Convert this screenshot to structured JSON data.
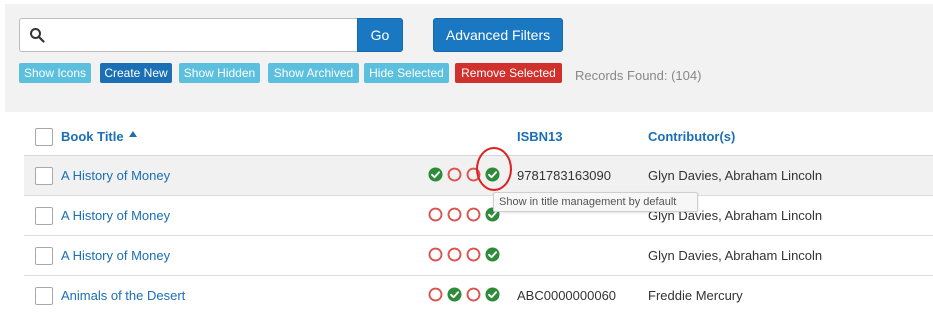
{
  "colors": {
    "primary": "#1a78c2",
    "link": "#1a6fb5",
    "info": "#5bc0de",
    "danger": "#d0312d",
    "status_on": "#2e8b3a",
    "status_off": "#d9534f",
    "highlight": "#e02020"
  },
  "search": {
    "placeholder": "",
    "value": "",
    "icon": "search-icon",
    "go_label": "Go"
  },
  "advanced_filters_label": "Advanced Filters",
  "toolbar_buttons": [
    {
      "label": "Show Icons",
      "style": "light"
    },
    {
      "label": "Create New",
      "style": "dark"
    },
    {
      "label": "Show Hidden",
      "style": "light"
    },
    {
      "label": "Show Archived",
      "style": "light"
    },
    {
      "label": "Hide Selected",
      "style": "light"
    },
    {
      "label": "Remove Selected",
      "style": "danger"
    }
  ],
  "records_found": "Records Found: (104)",
  "table": {
    "columns": {
      "title": "Book Title",
      "isbn": "ISBN13",
      "contributors": "Contributor(s)"
    },
    "sort": {
      "column": "title",
      "direction": "asc",
      "icon": "sort-up-icon"
    },
    "rows": [
      {
        "title": "A History of Money",
        "status": [
          "on",
          "off",
          "off",
          "on"
        ],
        "isbn": "9781783163090",
        "contributors": "Glyn Davies, Abraham Lincoln",
        "hovered": true
      },
      {
        "title": "A History of Money",
        "status": [
          "off",
          "off",
          "off",
          "on"
        ],
        "isbn": "",
        "contributors": "Glyn Davies, Abraham Lincoln",
        "hovered": false
      },
      {
        "title": "A History of Money",
        "status": [
          "off",
          "off",
          "off",
          "on"
        ],
        "isbn": "",
        "contributors": "Glyn Davies, Abraham Lincoln",
        "hovered": false
      },
      {
        "title": "Animals of the Desert",
        "status": [
          "off",
          "on",
          "off",
          "on"
        ],
        "isbn": "ABC0000000060",
        "contributors": "Freddie Mercury",
        "hovered": false
      }
    ]
  },
  "tooltip": "Show in title management by default"
}
